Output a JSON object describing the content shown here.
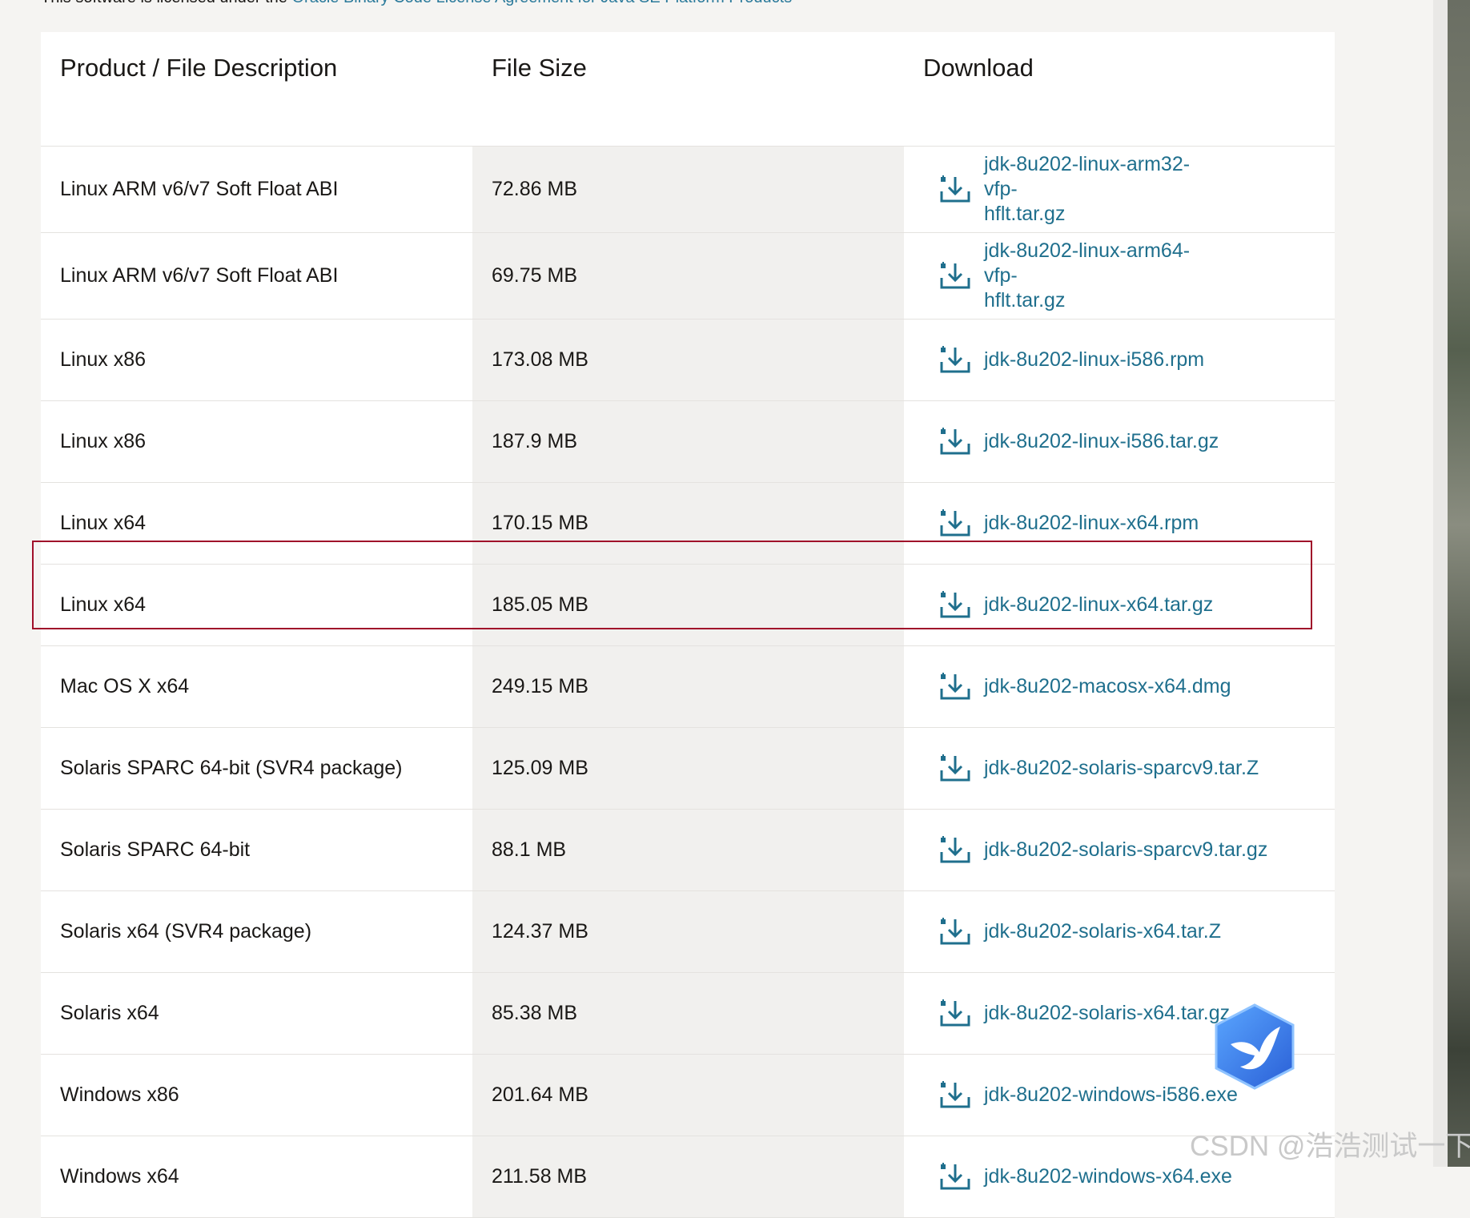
{
  "license": {
    "prefix": "This software is licensed under the ",
    "link": "Oracle Binary Code License Agreement for Java SE Platform Products"
  },
  "table": {
    "headers": [
      "Product / File Description",
      "File Size",
      "Download"
    ],
    "rows": [
      {
        "product": "Linux ARM v6/v7 Soft Float ABI",
        "size": "72.86 MB",
        "file": "jdk-8u202-linux-arm32-vfp-hflt.tar.gz"
      },
      {
        "product": "Linux ARM v6/v7 Soft Float ABI",
        "size": "69.75 MB",
        "file": "jdk-8u202-linux-arm64-vfp-hflt.tar.gz"
      },
      {
        "product": "Linux x86",
        "size": "173.08 MB",
        "file": "jdk-8u202-linux-i586.rpm"
      },
      {
        "product": "Linux x86",
        "size": "187.9 MB",
        "file": "jdk-8u202-linux-i586.tar.gz"
      },
      {
        "product": "Linux x64",
        "size": "170.15 MB",
        "file": "jdk-8u202-linux-x64.rpm"
      },
      {
        "product": "Linux x64",
        "size": "185.05 MB",
        "file": "jdk-8u202-linux-x64.tar.gz"
      },
      {
        "product": "Mac OS X x64",
        "size": "249.15 MB",
        "file": "jdk-8u202-macosx-x64.dmg"
      },
      {
        "product": "Solaris SPARC 64-bit (SVR4 package)",
        "size": "125.09 MB",
        "file": "jdk-8u202-solaris-sparcv9.tar.Z"
      },
      {
        "product": "Solaris SPARC 64-bit",
        "size": "88.1 MB",
        "file": "jdk-8u202-solaris-sparcv9.tar.gz"
      },
      {
        "product": "Solaris x64 (SVR4 package)",
        "size": "124.37 MB",
        "file": "jdk-8u202-solaris-x64.tar.Z"
      },
      {
        "product": "Solaris x64",
        "size": "85.38 MB",
        "file": "jdk-8u202-solaris-x64.tar.gz"
      },
      {
        "product": "Windows x86",
        "size": "201.64 MB",
        "file": "jdk-8u202-windows-i586.exe"
      },
      {
        "product": "Windows x64",
        "size": "211.58 MB",
        "file": "jdk-8u202-windows-x64.exe"
      }
    ]
  },
  "colors": {
    "link": "#1f6f8d",
    "highlight_border": "#a0102a",
    "size_column_bg": "#f1f0ee"
  },
  "icons": {
    "download": "download-icon",
    "badge": "bird-badge-icon"
  },
  "highlighted_row_index": 5,
  "watermark": "CSDN @浩浩测试一下"
}
